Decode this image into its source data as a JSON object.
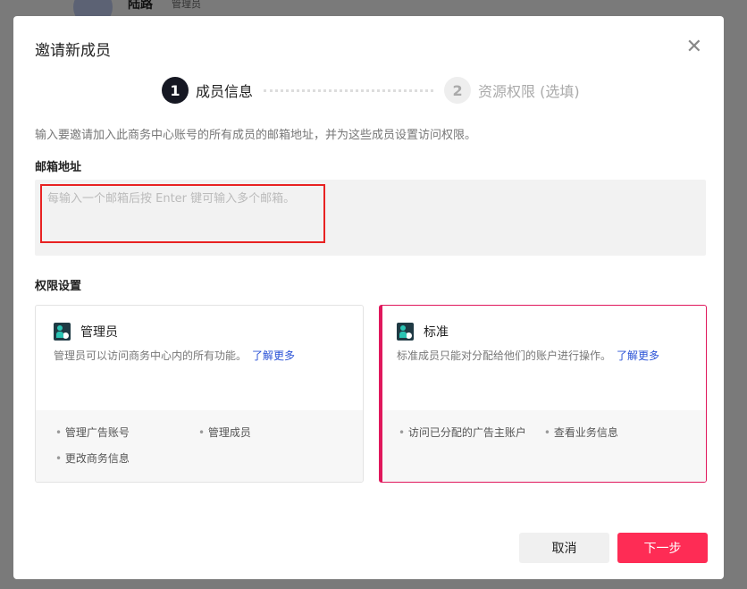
{
  "background": {
    "name": "陆路",
    "role": "管理员"
  },
  "modal": {
    "title": "邀请新成员",
    "close_icon": "close-icon",
    "steps": [
      {
        "num": "1",
        "label": "成员信息"
      },
      {
        "num": "2",
        "label": "资源权限 (选填)"
      }
    ],
    "description": "输入要邀请加入此商务中心账号的所有成员的邮箱地址，并为这些成员设置访问权限。",
    "email_label": "邮箱地址",
    "email_placeholder": "每输入一个邮箱后按 Enter 键可输入多个邮箱。",
    "permission_label": "权限设置",
    "roles": [
      {
        "name": "管理员",
        "description": "管理员可以访问商务中心内的所有功能。",
        "link": "了解更多",
        "features": [
          "管理广告账号",
          "管理成员",
          "更改商务信息"
        ],
        "selected": false
      },
      {
        "name": "标准",
        "description": "标准成员只能对分配给他们的账户进行操作。",
        "link": "了解更多",
        "features": [
          "访问已分配的广告主账户",
          "查看业务信息"
        ],
        "selected": true
      }
    ],
    "cancel": "取消",
    "next": "下一步",
    "colors": {
      "accent": "#fe2c55",
      "highlight": "#e82222"
    }
  }
}
